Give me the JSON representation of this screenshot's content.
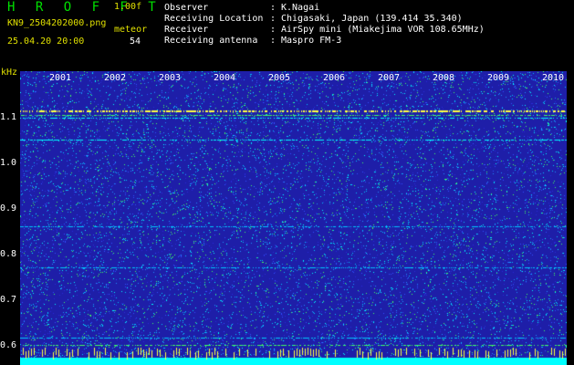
{
  "header": {
    "app_title": "H R O F F T",
    "version": "1.00f",
    "filename": "KN9_2504202000.png",
    "datetime": "25.04.20 20:00",
    "meteor_label": "meteor",
    "meteor_count": "54"
  },
  "station_info": {
    "separator": ":",
    "fields": [
      {
        "label": "Observer",
        "value": "K.Nagai"
      },
      {
        "label": "Receiving Location",
        "value": "Chigasaki, Japan (139.414 35.340)"
      },
      {
        "label": "Receiver",
        "value": "AirSpy mini (Miakejima VOR 108.65MHz)"
      },
      {
        "label": "Receiving antenna",
        "value": "Maspro FM-3"
      }
    ]
  },
  "spectrogram": {
    "unit_label": "kHz",
    "y_ticks": [
      "1.1",
      "1.0",
      "0.9",
      "0.8",
      "0.7",
      "0.6"
    ],
    "x_ticks": [
      "2001",
      "2002",
      "2003",
      "2004",
      "2005",
      "2006",
      "2007",
      "2008",
      "2009",
      "2010"
    ],
    "colors": {
      "background": "#1e1ea8",
      "speckle_cyan": "#00ffff",
      "speckle_green": "#40ff60",
      "speckle_yellow": "#ffff40",
      "bottom_band": "#00ffff"
    }
  }
}
